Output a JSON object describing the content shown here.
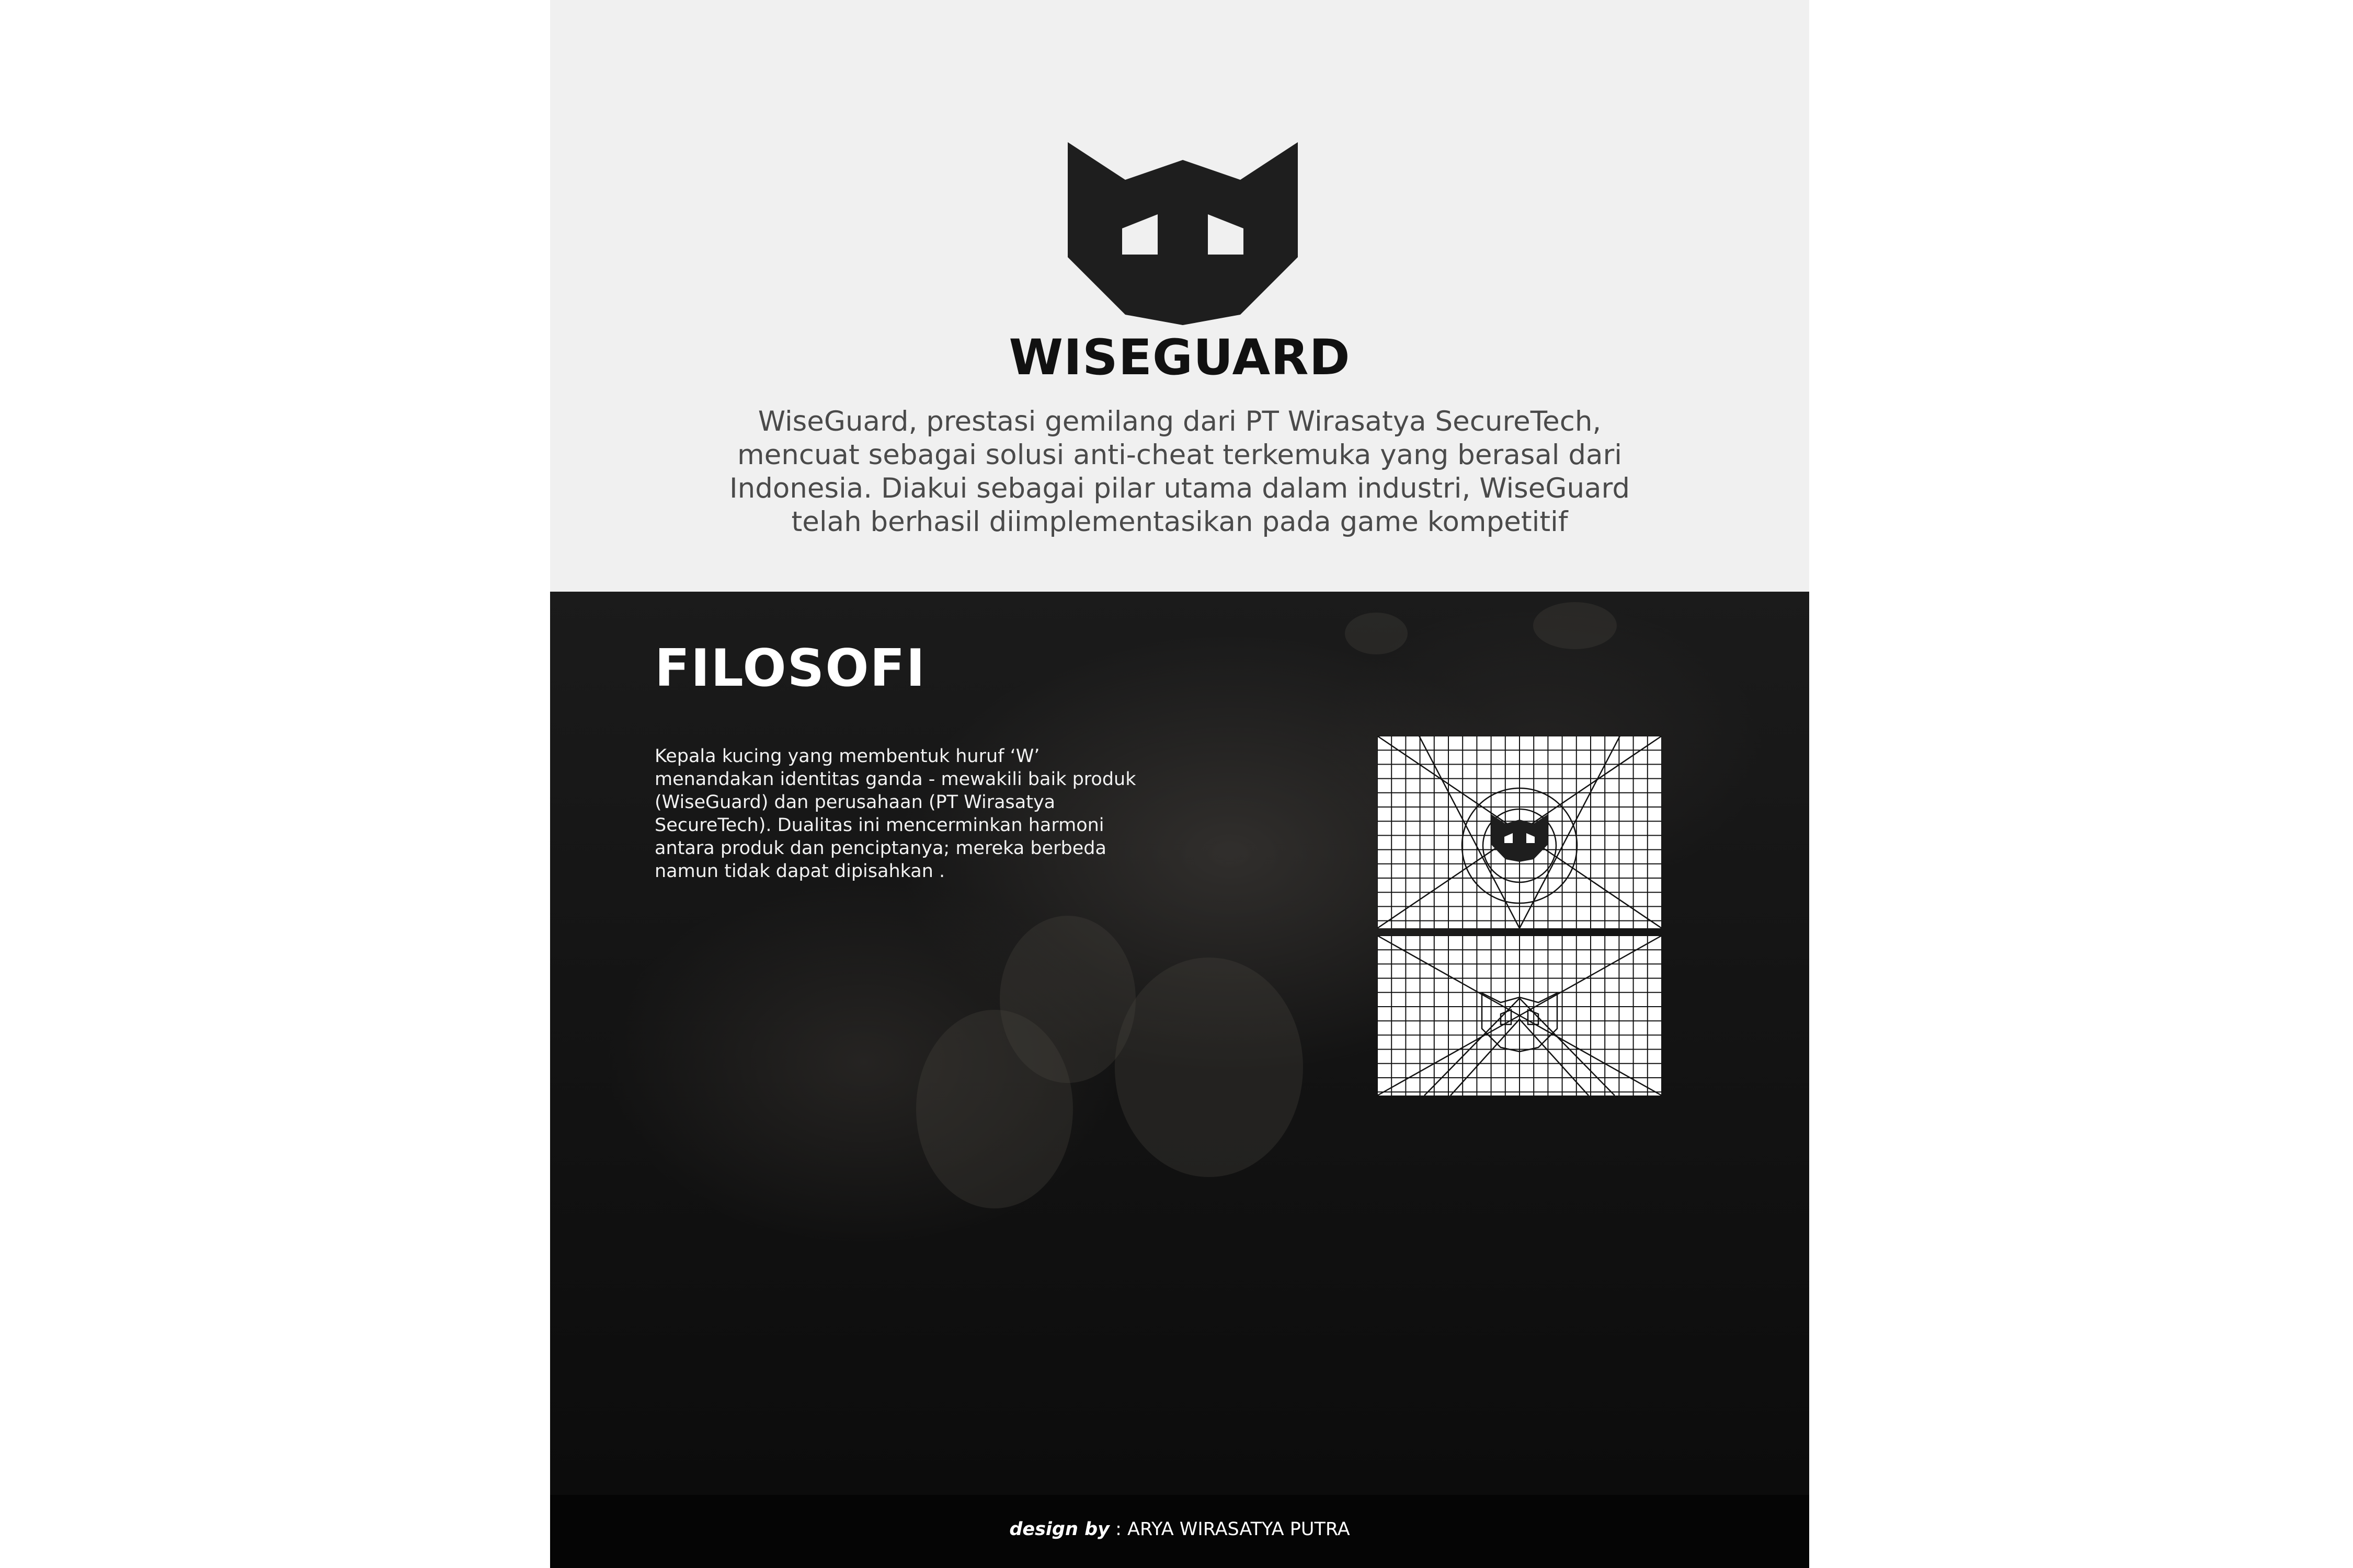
{
  "brand": {
    "name": "WISEGUARD",
    "logo_icon": "cat-head-w-logo-icon",
    "logo_color": "#1e1e1e"
  },
  "intro": {
    "lines": [
      "WiseGuard, prestasi gemilang dari PT Wirasatya SecureTech,",
      "mencuat sebagai solusi anti-cheat terkemuka yang berasal dari",
      "Indonesia. Diakui sebagai pilar utama dalam industri, WiseGuard",
      "telah berhasil diimplementasikan pada  game kompetitif"
    ]
  },
  "philosophy": {
    "title": "FILOSOFI",
    "body_lines": [
      "Kepala kucing yang membentuk huruf ‘W’",
      "menandakan identitas ganda - mewakili baik produk",
      "(WiseGuard) dan perusahaan (PT Wirasatya",
      "SecureTech). Dualitas ini mencerminkan harmoni",
      "antara produk dan penciptanya; mereka berbeda",
      "namun tidak dapat dipisahkan ."
    ],
    "construction_grids": [
      {
        "icon": "logo-construction-grid-filled-icon"
      },
      {
        "icon": "logo-construction-grid-outline-icon"
      }
    ]
  },
  "footer": {
    "credit_label": "design by",
    "credit_name": " : ARYA WIRASATYA PUTRA"
  },
  "colors": {
    "top_background": "#f0f0f0",
    "bottom_background": "#141414",
    "footer_background": "#050505",
    "text_dark": "#111111",
    "text_light": "#ffffff"
  }
}
